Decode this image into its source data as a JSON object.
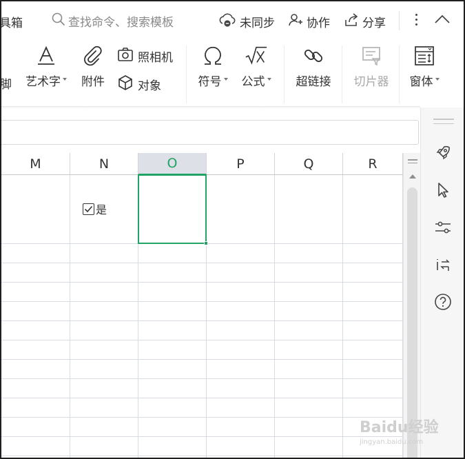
{
  "topbar": {
    "truncated_title": "具箱",
    "search_placeholder": "查找命令、搜索模板",
    "sync_label": "未同步",
    "collab_label": "协作",
    "share_label": "分享"
  },
  "ribbon": {
    "truncated_item": "脚",
    "wordart_label": "艺术字",
    "attachment_label": "附件",
    "camera_label": "照相机",
    "object_label": "对象",
    "symbol_label": "符号",
    "formula_label": "公式",
    "hyperlink_label": "超链接",
    "slicer_label": "切片器",
    "form_label": "窗体"
  },
  "grid": {
    "columns": [
      "M",
      "N",
      "O",
      "P",
      "Q",
      "R"
    ],
    "selected_column": "O",
    "checkbox_label": "是",
    "checkbox_checked": true
  },
  "colors": {
    "accent": "#21a366",
    "selected_header_bg": "#dde0e6",
    "gridline": "#d7dbe3"
  },
  "watermark": {
    "brand": "Baidu经验",
    "url": "jingyan.baidu.com"
  },
  "icons": [
    "search-icon",
    "cloud-sync-icon",
    "add-user-icon",
    "share-icon",
    "more-icon",
    "collapse-icon",
    "wordart-icon",
    "paperclip-icon",
    "camera-icon",
    "cube-icon",
    "omega-icon",
    "sqrt-x-icon",
    "link-icon",
    "slicer-icon",
    "form-icon",
    "rocket-icon",
    "pointer-icon",
    "sliders-icon",
    "swap-icon",
    "help-icon"
  ]
}
